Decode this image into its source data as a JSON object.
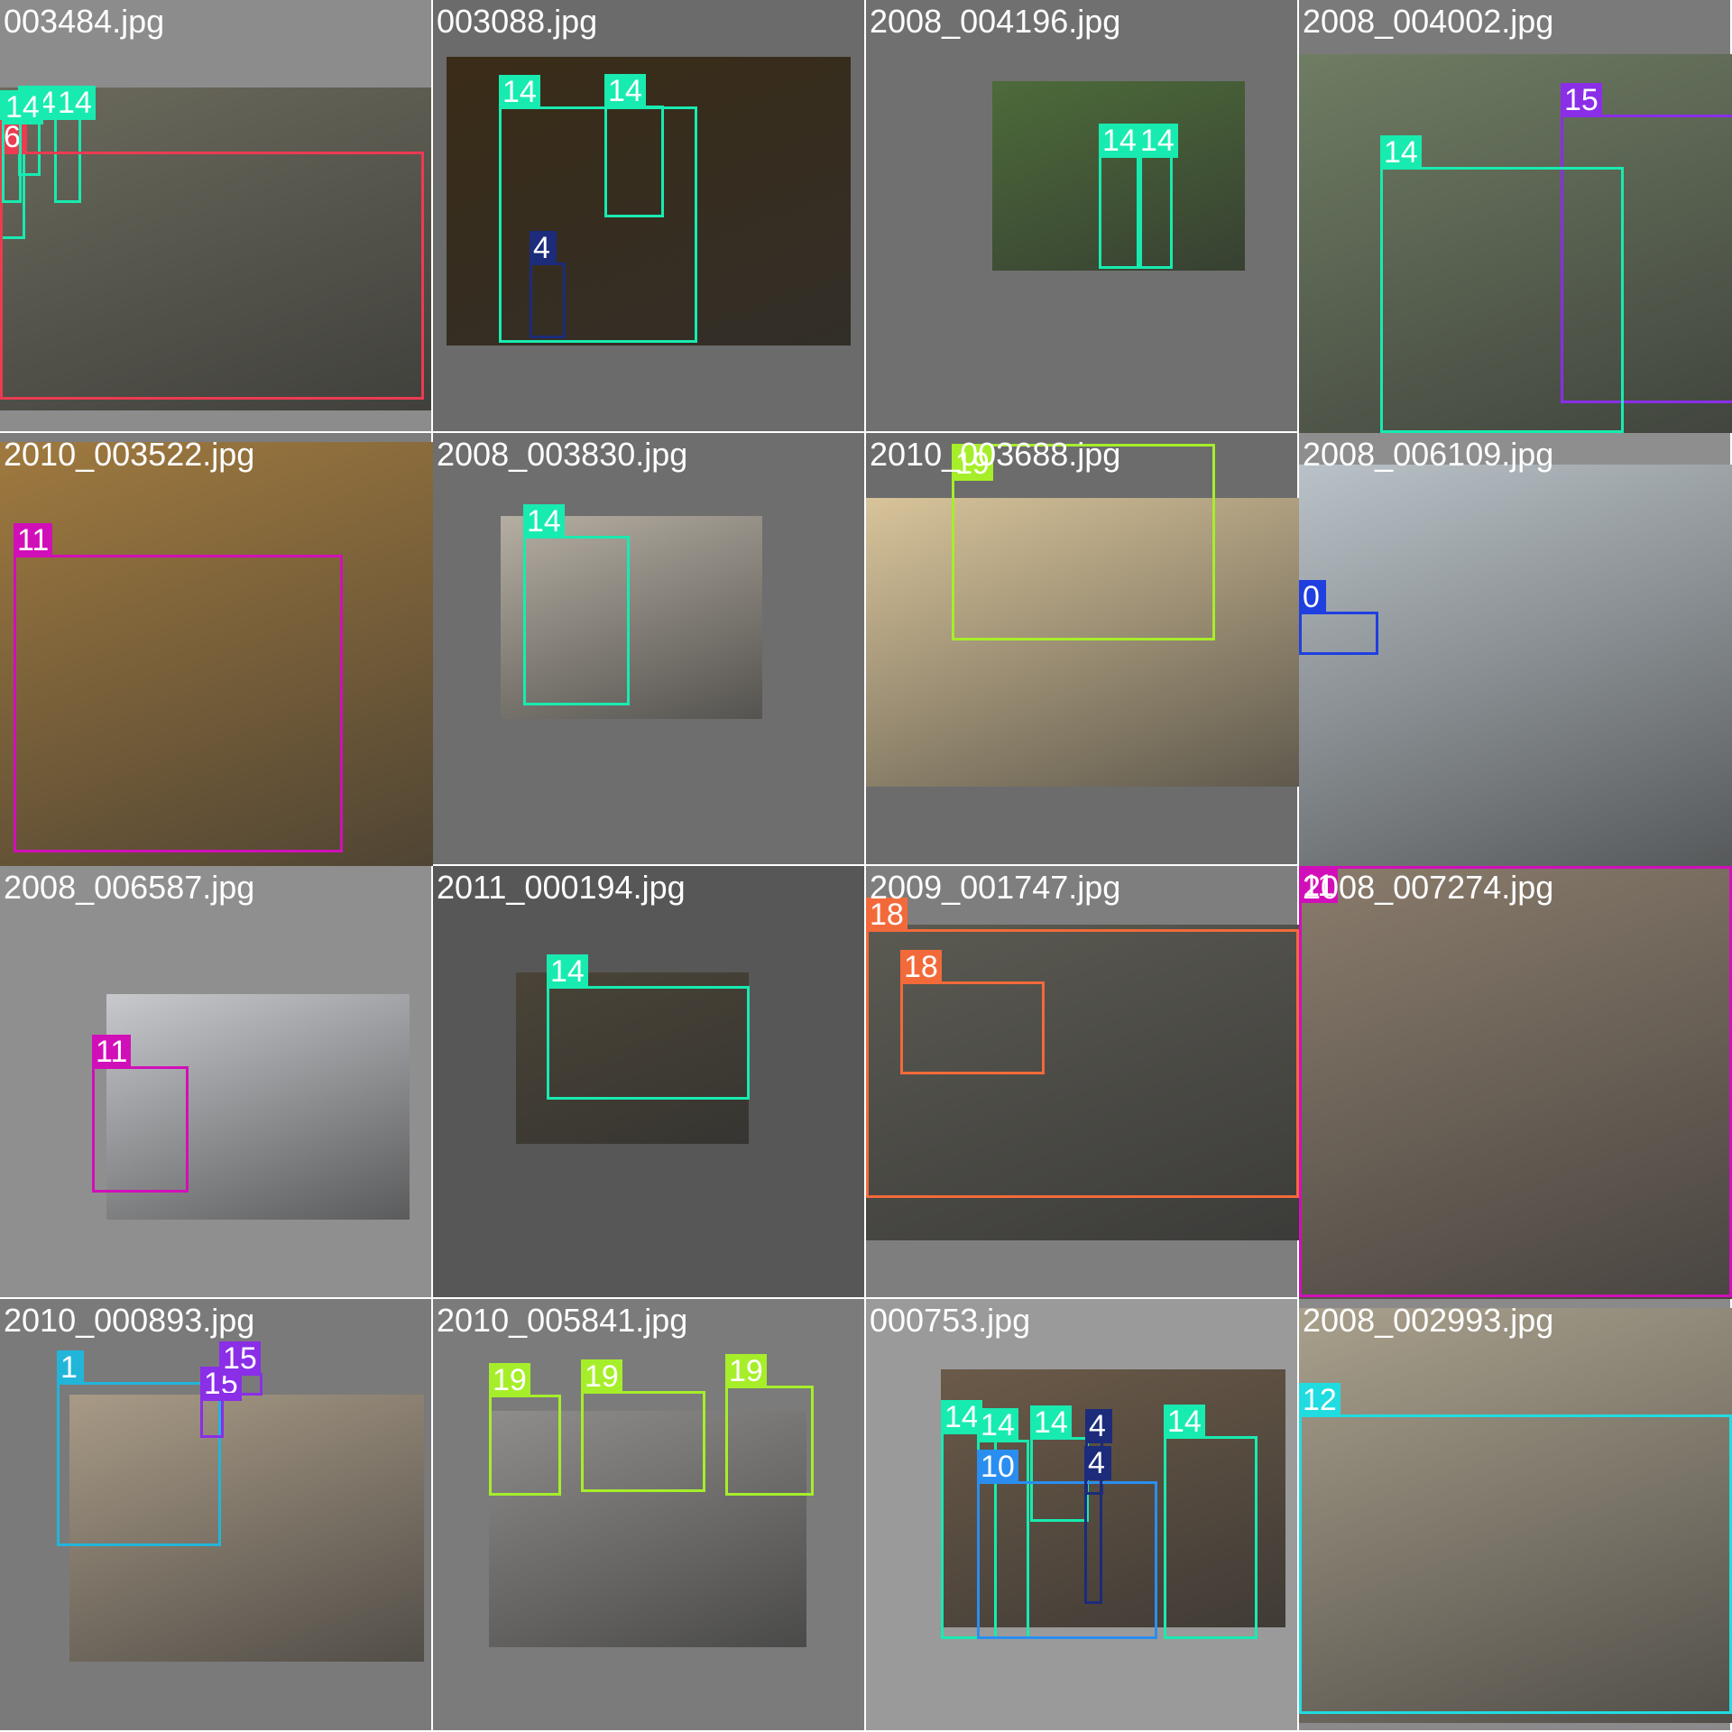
{
  "palette": {
    "cls_0": "#1f3fe0",
    "cls_1": "#22b5da",
    "cls_4": "#1c2b7a",
    "cls_6": "#ec3b52",
    "cls_10": "#2a8ef0",
    "cls_11": "#d10fb8",
    "cls_12": "#20dce0",
    "cls_14": "#18ebb0",
    "cls_15": "#8a2ee8",
    "cls_18": "#f36a3a",
    "cls_19": "#a6ee2a"
  },
  "tiles": [
    {
      "filename": "003484.jpg",
      "background": "#8c8c8c",
      "photo_fill": "#6b6a5c",
      "photo_name": "black-classic-car-photo",
      "boxes": [
        {
          "label": "14",
          "color": "#18ebb0",
          "icon": "person"
        },
        {
          "label": "14",
          "color": "#18ebb0",
          "icon": "person"
        },
        {
          "label": "14",
          "color": "#18ebb0",
          "icon": "person"
        },
        {
          "label": "6",
          "color": "#ec3b52",
          "icon": "car"
        },
        {
          "label": "14",
          "color": "#18ebb0",
          "icon": "person"
        }
      ]
    },
    {
      "filename": "003088.jpg",
      "background": "#6b6b6b",
      "photo_fill": "#3a2c17",
      "photo_name": "woman-in-parka-photo",
      "boxes": [
        {
          "label": "14",
          "color": "#18ebb0",
          "icon": "person"
        },
        {
          "label": "14",
          "color": "#18ebb0",
          "icon": "person"
        },
        {
          "label": "4",
          "color": "#1c2b7a",
          "icon": "bottle"
        }
      ]
    },
    {
      "filename": "2008_004196.jpg",
      "background": "#707070",
      "photo_fill": "#4d6b3a",
      "photo_name": "shark-statue-tourists-photo",
      "boxes": [
        {
          "label": "14",
          "color": "#18ebb0",
          "icon": "person"
        },
        {
          "label": "14",
          "color": "#18ebb0",
          "icon": "person"
        }
      ]
    },
    {
      "filename": "2008_004002.jpg",
      "background": "#7a7a7a",
      "photo_fill": "#6f7d63",
      "photo_name": "smiling-woman-plants-photo",
      "boxes": [
        {
          "label": "15",
          "color": "#8a2ee8",
          "icon": "pottedplant"
        },
        {
          "label": "14",
          "color": "#18ebb0",
          "icon": "person"
        }
      ]
    },
    {
      "filename": "2010_003522.jpg",
      "background": "#7d7d7d",
      "photo_fill": "#a07a3f",
      "photo_name": "dog-with-collar-photo",
      "boxes": [
        {
          "label": "11",
          "color": "#d10fb8",
          "icon": "dog"
        }
      ]
    },
    {
      "filename": "2008_003830.jpg",
      "background": "#6e6e6e",
      "photo_fill": "#b5aea2",
      "photo_name": "sleeping-baby-photo",
      "boxes": [
        {
          "label": "14",
          "color": "#18ebb0",
          "icon": "person"
        }
      ]
    },
    {
      "filename": "2010_003688.jpg",
      "background": "#6c6c6c",
      "photo_fill": "#d8c49a",
      "photo_name": "tv-on-stand-photo",
      "boxes": [
        {
          "label": "19",
          "color": "#a6ee2a",
          "icon": "tvmonitor"
        }
      ]
    },
    {
      "filename": "2008_006109.jpg",
      "background": "#8e8e8e",
      "photo_fill": "#b9c2c8",
      "photo_name": "airplane-in-sky-photo",
      "boxes": [
        {
          "label": "0",
          "color": "#1f3fe0",
          "icon": "aeroplane"
        }
      ]
    },
    {
      "filename": "2008_006587.jpg",
      "background": "#8f8f8f",
      "photo_fill": "#c7c9cd",
      "photo_name": "black-dog-on-driveway-photo",
      "boxes": [
        {
          "label": "11",
          "color": "#d10fb8",
          "icon": "dog"
        }
      ]
    },
    {
      "filename": "2011_000194.jpg",
      "background": "#575757",
      "photo_fill": "#4a4437",
      "photo_name": "person-sleeping-under-table-photo",
      "boxes": [
        {
          "label": "14",
          "color": "#18ebb0",
          "icon": "person"
        }
      ]
    },
    {
      "filename": "2009_001747.jpg",
      "background": "#7e7e7e",
      "photo_fill": "#5b5a52",
      "photo_name": "locomotives-photo",
      "boxes": [
        {
          "label": "18",
          "color": "#f36a3a",
          "icon": "train"
        },
        {
          "label": "18",
          "color": "#f36a3a",
          "icon": "train"
        }
      ]
    },
    {
      "filename": "2008_007274.jpg",
      "background": "#7f7f7f",
      "photo_fill": "#8a7c6c",
      "photo_name": "dog-closeup-photo",
      "boxes": [
        {
          "label": "11",
          "color": "#d10fb8",
          "icon": "dog"
        }
      ]
    },
    {
      "filename": "2010_000893.jpg",
      "background": "#7a7a7a",
      "photo_fill": "#a89a86",
      "photo_name": "bicycle-in-room-photo",
      "boxes": [
        {
          "label": "1",
          "color": "#22b5da",
          "icon": "bicycle"
        },
        {
          "label": "15",
          "color": "#8a2ee8",
          "icon": "pottedplant"
        },
        {
          "label": "15",
          "color": "#8a2ee8",
          "icon": "pottedplant"
        }
      ]
    },
    {
      "filename": "2010_005841.jpg",
      "background": "#7b7b7b",
      "photo_fill": "#8f8d8b",
      "photo_name": "three-monitors-desk-photo",
      "boxes": [
        {
          "label": "19",
          "color": "#a6ee2a",
          "icon": "tvmonitor"
        },
        {
          "label": "19",
          "color": "#a6ee2a",
          "icon": "tvmonitor"
        },
        {
          "label": "19",
          "color": "#a6ee2a",
          "icon": "tvmonitor"
        }
      ]
    },
    {
      "filename": "000753.jpg",
      "background": "#9a9a9a",
      "photo_fill": "#6b5a48",
      "photo_name": "group-at-dinner-table-photo",
      "boxes": [
        {
          "label": "14",
          "color": "#18ebb0",
          "icon": "person"
        },
        {
          "label": "14",
          "color": "#18ebb0",
          "icon": "person"
        },
        {
          "label": "14",
          "color": "#18ebb0",
          "icon": "person"
        },
        {
          "label": "4",
          "color": "#1c2b7a",
          "icon": "bottle"
        },
        {
          "label": "14",
          "color": "#18ebb0",
          "icon": "person"
        },
        {
          "label": "10",
          "color": "#2a8ef0",
          "icon": "diningtable"
        },
        {
          "label": "4",
          "color": "#1c2b7a",
          "icon": "bottle"
        }
      ]
    },
    {
      "filename": "2008_002993.jpg",
      "background": "#8a8a8a",
      "photo_fill": "#a9a08c",
      "photo_name": "horse-in-corral-photo",
      "boxes": [
        {
          "label": "12",
          "color": "#20dce0",
          "icon": "horse"
        }
      ]
    }
  ]
}
